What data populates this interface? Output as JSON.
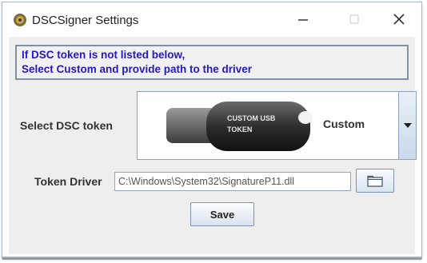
{
  "window": {
    "title": "DSCSigner Settings"
  },
  "info": {
    "line1": "If DSC token is not listed below,",
    "line2": "Select Custom and provide path to the driver"
  },
  "token": {
    "label": "Select DSC token",
    "selected_value": "Custom",
    "image_text_line1": "CUSTOM USB",
    "image_text_line2": "TOKEN"
  },
  "driver": {
    "label": "Token Driver",
    "path_value": "C:\\Windows\\System32\\SignatureP11.dll"
  },
  "buttons": {
    "save_label": "Save"
  },
  "colors": {
    "info_text": "#2418c8",
    "label_text": "#333333",
    "client_bg": "#eeeeee"
  }
}
